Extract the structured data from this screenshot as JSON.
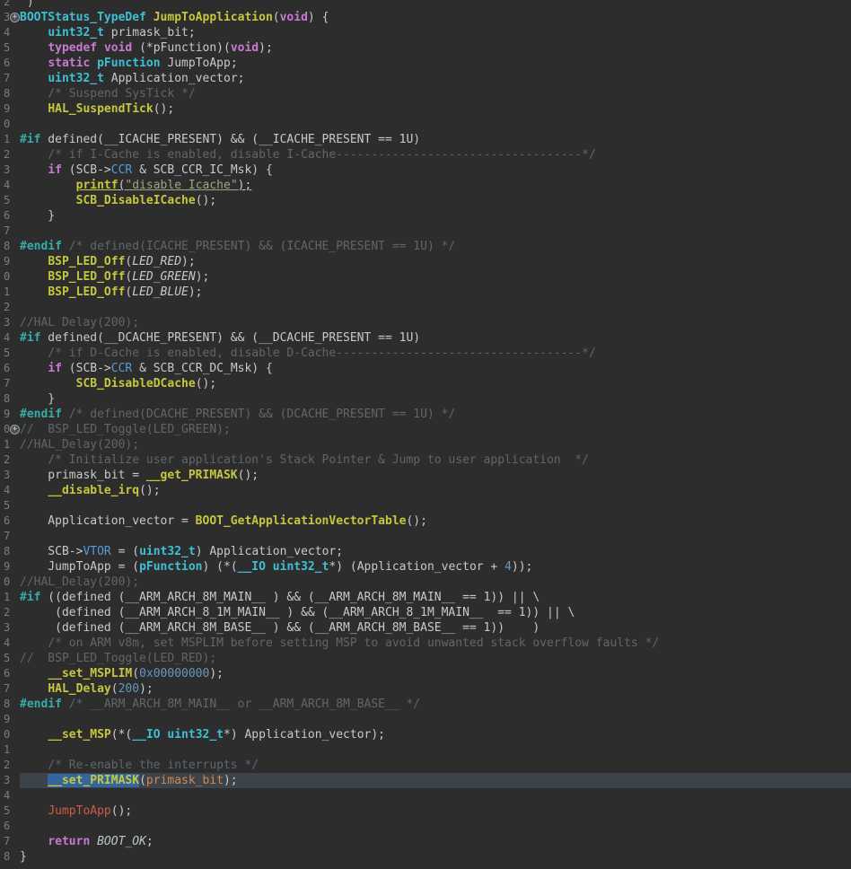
{
  "app": {
    "type": "code-editor",
    "language": "c"
  },
  "theme": {
    "background": "#2d2d2d",
    "gutter_number_color": "#7d7d7d",
    "current_line_background": "#3d434a",
    "selection_background": "#33669e",
    "token_colors": {
      "p": "#c9c9c9",
      "kw": "#c87ad2",
      "ty": "#3dc0d3",
      "fn": "#c6c73d",
      "pp": "#35ada5",
      "cm": "#5f666b",
      "nu": "#6897bb",
      "fl": "#569cd6",
      "st": "#9aa883",
      "mc": "#c9c9c9",
      "en": "#bdc7c7",
      "or": "#d18a4a",
      "rd": "#cf5b45"
    }
  },
  "editor": {
    "selected_text": "__set_PRIMASK",
    "current_line_text": "__set_PRIMASK(primask_bit);",
    "bookmark_icon_glyph": "+",
    "lines": [
      {
        "n": "2",
        "seg": [
          {
            "s": "p",
            "t": " )"
          }
        ]
      },
      {
        "n": "3",
        "marker": true,
        "seg": [
          {
            "s": "ty",
            "t": "BOOTStatus_TypeDef"
          },
          {
            "s": "p",
            "t": " "
          },
          {
            "s": "fn",
            "t": "JumpToApplication"
          },
          {
            "s": "p",
            "t": "("
          },
          {
            "s": "kw",
            "t": "void"
          },
          {
            "s": "p",
            "t": ") {"
          }
        ]
      },
      {
        "n": "4",
        "seg": [
          {
            "s": "p",
            "t": "    "
          },
          {
            "s": "ty",
            "t": "uint32_t"
          },
          {
            "s": "p",
            "t": " primask_bit;"
          }
        ]
      },
      {
        "n": "5",
        "seg": [
          {
            "s": "p",
            "t": "    "
          },
          {
            "s": "kw",
            "t": "typedef"
          },
          {
            "s": "p",
            "t": " "
          },
          {
            "s": "kw",
            "t": "void"
          },
          {
            "s": "p",
            "t": " (*pFunction)("
          },
          {
            "s": "kw",
            "t": "void"
          },
          {
            "s": "p",
            "t": ");"
          }
        ]
      },
      {
        "n": "6",
        "seg": [
          {
            "s": "p",
            "t": "    "
          },
          {
            "s": "kw",
            "t": "static"
          },
          {
            "s": "p",
            "t": " "
          },
          {
            "s": "ty",
            "t": "pFunction"
          },
          {
            "s": "p",
            "t": " JumpToApp;"
          }
        ]
      },
      {
        "n": "7",
        "seg": [
          {
            "s": "p",
            "t": "    "
          },
          {
            "s": "ty",
            "t": "uint32_t"
          },
          {
            "s": "p",
            "t": " Application_vector;"
          }
        ]
      },
      {
        "n": "8",
        "seg": [
          {
            "s": "p",
            "t": "    "
          },
          {
            "s": "cm",
            "t": "/* Suspend SysTick */"
          }
        ]
      },
      {
        "n": "9",
        "seg": [
          {
            "s": "p",
            "t": "    "
          },
          {
            "s": "fn",
            "t": "HAL_SuspendTick"
          },
          {
            "s": "p",
            "t": "();"
          }
        ]
      },
      {
        "n": "0",
        "seg": []
      },
      {
        "n": "1",
        "seg": [
          {
            "s": "pp",
            "t": "#if"
          },
          {
            "s": "p",
            "t": " defined(__ICACHE_PRESENT) && (__ICACHE_PRESENT == 1U)"
          }
        ]
      },
      {
        "n": "2",
        "seg": [
          {
            "s": "p",
            "t": "    "
          },
          {
            "s": "cm",
            "t": "/* if I-Cache is enabled, disable I-Cache-----------------------------------*/"
          }
        ]
      },
      {
        "n": "3",
        "seg": [
          {
            "s": "p",
            "t": "    "
          },
          {
            "s": "kw",
            "t": "if"
          },
          {
            "s": "p",
            "t": " (SCB->"
          },
          {
            "s": "fl",
            "t": "CCR"
          },
          {
            "s": "p",
            "t": " & SCB_CCR_IC_Msk) {"
          }
        ]
      },
      {
        "n": "4",
        "seg": [
          {
            "s": "p",
            "t": "        "
          },
          {
            "s": "fn",
            "t": "printf",
            "u": true
          },
          {
            "s": "p",
            "t": "(",
            "u": true
          },
          {
            "s": "st",
            "t": "\"disable Icache\"",
            "u": true
          },
          {
            "s": "p",
            "t": ");",
            "u": true
          }
        ]
      },
      {
        "n": "5",
        "seg": [
          {
            "s": "p",
            "t": "        "
          },
          {
            "s": "fn",
            "t": "SCB_DisableICache"
          },
          {
            "s": "p",
            "t": "();"
          }
        ]
      },
      {
        "n": "6",
        "seg": [
          {
            "s": "p",
            "t": "    }"
          }
        ]
      },
      {
        "n": "7",
        "seg": []
      },
      {
        "n": "8",
        "seg": [
          {
            "s": "pp",
            "t": "#endif"
          },
          {
            "s": "p",
            "t": " "
          },
          {
            "s": "cm",
            "t": "/* defined(ICACHE_PRESENT) && (ICACHE_PRESENT == 1U) */"
          }
        ]
      },
      {
        "n": "9",
        "seg": [
          {
            "s": "p",
            "t": "    "
          },
          {
            "s": "fn",
            "t": "BSP_LED_Off"
          },
          {
            "s": "p",
            "t": "("
          },
          {
            "s": "mc",
            "t": "LED_RED"
          },
          {
            "s": "p",
            "t": ");"
          }
        ]
      },
      {
        "n": "0",
        "seg": [
          {
            "s": "p",
            "t": "    "
          },
          {
            "s": "fn",
            "t": "BSP_LED_Off"
          },
          {
            "s": "p",
            "t": "("
          },
          {
            "s": "mc",
            "t": "LED_GREEN"
          },
          {
            "s": "p",
            "t": ");"
          }
        ]
      },
      {
        "n": "1",
        "seg": [
          {
            "s": "p",
            "t": "    "
          },
          {
            "s": "fn",
            "t": "BSP_LED_Off"
          },
          {
            "s": "p",
            "t": "("
          },
          {
            "s": "mc",
            "t": "LED_BLUE"
          },
          {
            "s": "p",
            "t": ");"
          }
        ]
      },
      {
        "n": "2",
        "seg": []
      },
      {
        "n": "3",
        "seg": [
          {
            "s": "cm",
            "t": "//HAL Delay(200);"
          }
        ]
      },
      {
        "n": "4",
        "seg": [
          {
            "s": "pp",
            "t": "#if"
          },
          {
            "s": "p",
            "t": " defined(__DCACHE_PRESENT) && (__DCACHE_PRESENT == 1U)"
          }
        ]
      },
      {
        "n": "5",
        "seg": [
          {
            "s": "p",
            "t": "    "
          },
          {
            "s": "cm",
            "t": "/* if D-Cache is enabled, disable D-Cache-----------------------------------*/"
          }
        ]
      },
      {
        "n": "6",
        "seg": [
          {
            "s": "p",
            "t": "    "
          },
          {
            "s": "kw",
            "t": "if"
          },
          {
            "s": "p",
            "t": " (SCB->"
          },
          {
            "s": "fl",
            "t": "CCR"
          },
          {
            "s": "p",
            "t": " & SCB_CCR_DC_Msk) {"
          }
        ]
      },
      {
        "n": "7",
        "seg": [
          {
            "s": "p",
            "t": "        "
          },
          {
            "s": "fn",
            "t": "SCB_DisableDCache"
          },
          {
            "s": "p",
            "t": "();"
          }
        ]
      },
      {
        "n": "8",
        "seg": [
          {
            "s": "p",
            "t": "    }"
          }
        ]
      },
      {
        "n": "9",
        "seg": [
          {
            "s": "pp",
            "t": "#endif"
          },
          {
            "s": "p",
            "t": " "
          },
          {
            "s": "cm",
            "t": "/* defined(DCACHE_PRESENT) && (DCACHE_PRESENT == 1U) */"
          }
        ]
      },
      {
        "n": "0",
        "marker": true,
        "seg": [
          {
            "s": "cm",
            "t": "//  BSP_LED_Toggle(LED_GREEN);"
          }
        ]
      },
      {
        "n": "1",
        "seg": [
          {
            "s": "cm",
            "t": "//HAL_Delay(200);"
          }
        ]
      },
      {
        "n": "2",
        "seg": [
          {
            "s": "p",
            "t": "    "
          },
          {
            "s": "cm",
            "t": "/* Initialize user application's Stack Pointer & Jump to user application  */"
          }
        ]
      },
      {
        "n": "3",
        "seg": [
          {
            "s": "p",
            "t": "    primask_bit = "
          },
          {
            "s": "fn",
            "t": "__get_PRIMASK"
          },
          {
            "s": "p",
            "t": "();"
          }
        ]
      },
      {
        "n": "4",
        "seg": [
          {
            "s": "p",
            "t": "    "
          },
          {
            "s": "fn",
            "t": "__disable_irq"
          },
          {
            "s": "p",
            "t": "();"
          }
        ]
      },
      {
        "n": "5",
        "seg": []
      },
      {
        "n": "6",
        "seg": [
          {
            "s": "p",
            "t": "    Application_vector = "
          },
          {
            "s": "fn",
            "t": "BOOT_GetApplicationVectorTable"
          },
          {
            "s": "p",
            "t": "();"
          }
        ]
      },
      {
        "n": "7",
        "seg": []
      },
      {
        "n": "8",
        "seg": [
          {
            "s": "p",
            "t": "    SCB->"
          },
          {
            "s": "fl",
            "t": "VTOR"
          },
          {
            "s": "p",
            "t": " = ("
          },
          {
            "s": "ty",
            "t": "uint32_t"
          },
          {
            "s": "p",
            "t": ") Application_vector;"
          }
        ]
      },
      {
        "n": "9",
        "seg": [
          {
            "s": "p",
            "t": "    JumpToApp = ("
          },
          {
            "s": "ty",
            "t": "pFunction"
          },
          {
            "s": "p",
            "t": ") (*("
          },
          {
            "s": "ty",
            "t": "__IO uint32_t"
          },
          {
            "s": "p",
            "t": "*) (Application_vector + "
          },
          {
            "s": "nu",
            "t": "4"
          },
          {
            "s": "p",
            "t": "));"
          }
        ]
      },
      {
        "n": "0",
        "seg": [
          {
            "s": "cm",
            "t": "//HAL_Delay(200);"
          }
        ]
      },
      {
        "n": "1",
        "seg": [
          {
            "s": "pp",
            "t": "#if"
          },
          {
            "s": "p",
            "t": " ((defined (__ARM_ARCH_8M_MAIN__ ) && (__ARM_ARCH_8M_MAIN__ == 1)) || \\"
          }
        ]
      },
      {
        "n": "2",
        "seg": [
          {
            "s": "p",
            "t": "     (defined (__ARM_ARCH_8_1M_MAIN__ ) && (__ARM_ARCH_8_1M_MAIN__  == 1)) || \\"
          }
        ]
      },
      {
        "n": "3",
        "seg": [
          {
            "s": "p",
            "t": "     (defined (__ARM_ARCH_8M_BASE__ ) && (__ARM_ARCH_8M_BASE__ == 1))    )"
          }
        ]
      },
      {
        "n": "4",
        "seg": [
          {
            "s": "p",
            "t": "    "
          },
          {
            "s": "cm",
            "t": "/* on ARM v8m, set MSPLIM before setting MSP to avoid unwanted stack overflow faults */"
          }
        ]
      },
      {
        "n": "5",
        "seg": [
          {
            "s": "cm",
            "t": "//  BSP_LED_Toggle(LED_RED);"
          }
        ]
      },
      {
        "n": "6",
        "seg": [
          {
            "s": "p",
            "t": "    "
          },
          {
            "s": "fn",
            "t": "__set_MSPLIM"
          },
          {
            "s": "p",
            "t": "("
          },
          {
            "s": "nu",
            "t": "0x00000000"
          },
          {
            "s": "p",
            "t": ");"
          }
        ]
      },
      {
        "n": "7",
        "seg": [
          {
            "s": "p",
            "t": "    "
          },
          {
            "s": "fn",
            "t": "HAL_Delay"
          },
          {
            "s": "p",
            "t": "("
          },
          {
            "s": "nu",
            "t": "200"
          },
          {
            "s": "p",
            "t": ");"
          }
        ]
      },
      {
        "n": "8",
        "seg": [
          {
            "s": "pp",
            "t": "#endif"
          },
          {
            "s": "p",
            "t": " "
          },
          {
            "s": "cm",
            "t": "/* __ARM_ARCH_8M_MAIN__ or __ARM_ARCH_8M_BASE__ */"
          }
        ]
      },
      {
        "n": "9",
        "seg": []
      },
      {
        "n": "0",
        "seg": [
          {
            "s": "p",
            "t": "    "
          },
          {
            "s": "fn",
            "t": "__set_MSP"
          },
          {
            "s": "p",
            "t": "(*("
          },
          {
            "s": "ty",
            "t": "__IO uint32_t"
          },
          {
            "s": "p",
            "t": "*) Application_vector);"
          }
        ]
      },
      {
        "n": "1",
        "seg": []
      },
      {
        "n": "2",
        "seg": [
          {
            "s": "p",
            "t": "    "
          },
          {
            "s": "cm",
            "t": "/* Re-enable the interrupts */"
          }
        ]
      },
      {
        "n": "3",
        "current": true,
        "seg": [
          {
            "s": "p",
            "t": "    "
          },
          {
            "s": "fn",
            "t": "__set_PRIMASK",
            "sel": true
          },
          {
            "s": "p",
            "t": "("
          },
          {
            "s": "or",
            "t": "primask_bit"
          },
          {
            "s": "p",
            "t": ");"
          }
        ]
      },
      {
        "n": "4",
        "seg": []
      },
      {
        "n": "5",
        "seg": [
          {
            "s": "p",
            "t": "    "
          },
          {
            "s": "rd",
            "t": "JumpToApp"
          },
          {
            "s": "p",
            "t": "();"
          }
        ]
      },
      {
        "n": "6",
        "seg": []
      },
      {
        "n": "7",
        "seg": [
          {
            "s": "p",
            "t": "    "
          },
          {
            "s": "kw",
            "t": "return"
          },
          {
            "s": "p",
            "t": " "
          },
          {
            "s": "en",
            "t": "BOOT_OK"
          },
          {
            "s": "p",
            "t": ";"
          }
        ]
      },
      {
        "n": "8",
        "seg": [
          {
            "s": "p",
            "t": "}"
          }
        ]
      }
    ]
  }
}
